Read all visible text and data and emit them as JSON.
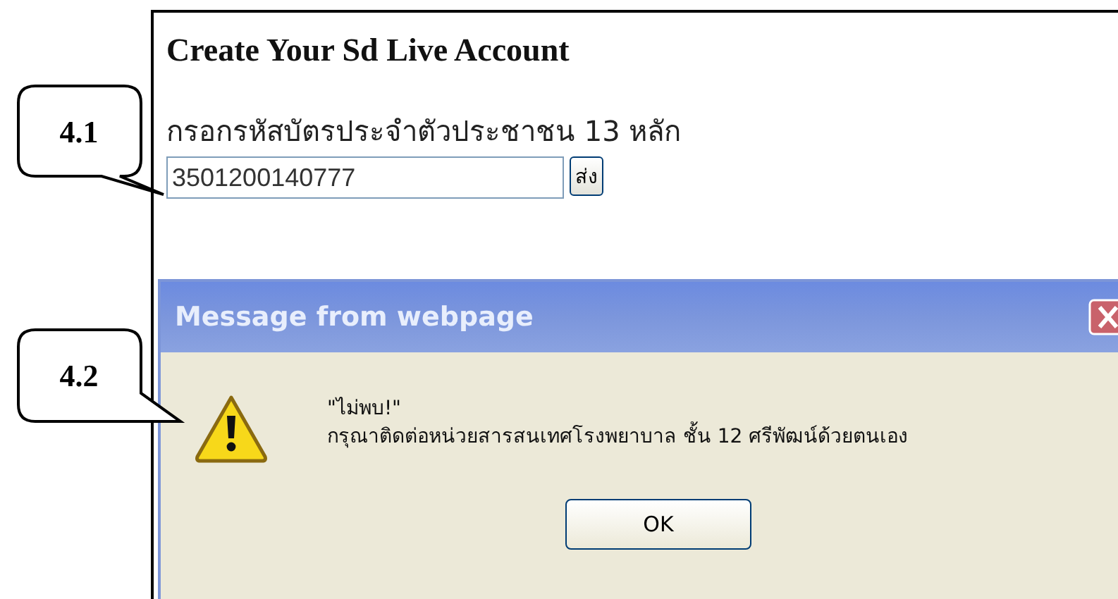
{
  "page": {
    "heading": "Create Your Sd Live Account",
    "field_label": "กรอกรหัสบัตรประจำตัวประชาชน 13 หลัก",
    "id_field": {
      "value": "3501200140777"
    },
    "submit_button": "ส่ง"
  },
  "dialog": {
    "title": "Message from webpage",
    "message_lines": [
      "\"ไม่พบ!\"",
      "กรุณาติดต่อหน่วยสารสนเทศโรงพยาบาล ชั้น 12 ศรีพัฒน์ด้วยตนเอง"
    ],
    "button": "OK"
  },
  "callouts": [
    {
      "label": "4.1",
      "kind": "down"
    },
    {
      "label": "4.2",
      "kind": "side"
    }
  ]
}
